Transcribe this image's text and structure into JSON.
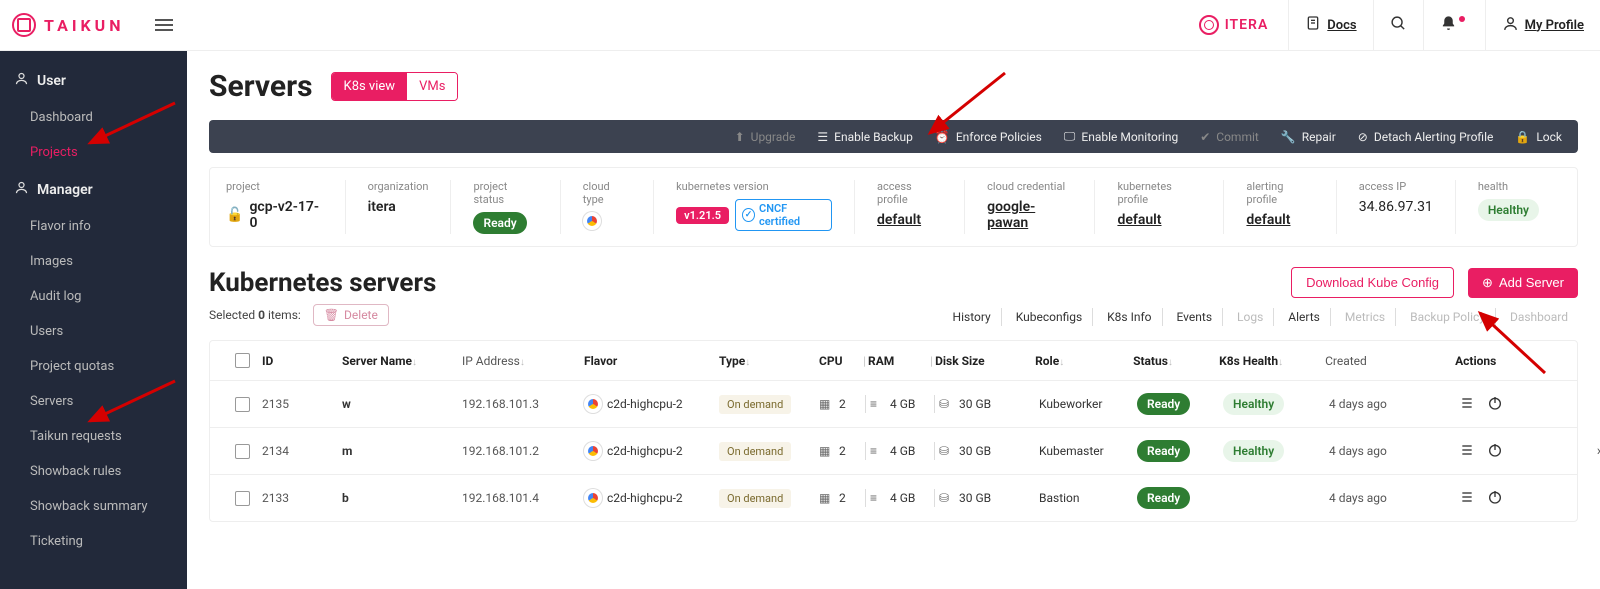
{
  "brand": {
    "name": "TAIKUN",
    "org": "ITERA"
  },
  "header": {
    "docs": "Docs",
    "profile": "My Profile"
  },
  "sidebar": {
    "user_section": "User",
    "manager_section": "Manager",
    "user_items": [
      {
        "label": "Dashboard",
        "active": false
      },
      {
        "label": "Projects",
        "active": true
      }
    ],
    "manager_items": [
      {
        "label": "Flavor info"
      },
      {
        "label": "Images"
      },
      {
        "label": "Audit log"
      },
      {
        "label": "Users"
      },
      {
        "label": "Project quotas"
      },
      {
        "label": "Servers"
      },
      {
        "label": "Taikun requests"
      },
      {
        "label": "Showback rules"
      },
      {
        "label": "Showback summary"
      },
      {
        "label": "Ticketing"
      }
    ]
  },
  "page_title": "Servers",
  "view_tabs": {
    "k8s": "K8s view",
    "vms": "VMs"
  },
  "action_bar": {
    "upgrade": "Upgrade",
    "enable_backup": "Enable Backup",
    "enforce_policies": "Enforce Policies",
    "enable_monitoring": "Enable Monitoring",
    "commit": "Commit",
    "repair": "Repair",
    "detach_alerting": "Detach Alerting Profile",
    "lock": "Lock"
  },
  "meta": {
    "project_lbl": "project",
    "project": "gcp-v2-17-0",
    "org_lbl": "organization",
    "org": "itera",
    "status_lbl": "project status",
    "status": "Ready",
    "cloud_lbl": "cloud type",
    "kver_lbl": "kubernetes version",
    "kver": "v1.21.5",
    "kcert": "CNCF certified",
    "access_lbl": "access profile",
    "access": "default",
    "cred_lbl": "cloud credential",
    "cred": "google-pawan",
    "kprofile_lbl": "kubernetes profile",
    "kprofile": "default",
    "alert_lbl": "alerting profile",
    "alert": "default",
    "ip_lbl": "access IP",
    "ip": "34.86.97.31",
    "health_lbl": "health",
    "health": "Healthy"
  },
  "sub_title": "Kubernetes servers",
  "buttons": {
    "download": "Download Kube Config",
    "add": "Add Server",
    "delete": "Delete"
  },
  "selected": {
    "prefix": "Selected ",
    "count": "0",
    "suffix": " items:"
  },
  "links": {
    "history": "History",
    "kubeconfigs": "Kubeconfigs",
    "k8sinfo": "K8s Info",
    "events": "Events",
    "logs": "Logs",
    "alerts": "Alerts",
    "metrics": "Metrics",
    "backup": "Backup Policy",
    "dashboard": "Dashboard"
  },
  "cols": {
    "id": "ID",
    "name": "Server Name",
    "ip": "IP Address",
    "flavor": "Flavor",
    "type": "Type",
    "cpu": "CPU",
    "ram": "RAM",
    "disk": "Disk Size",
    "role": "Role",
    "status": "Status",
    "health": "K8s Health",
    "created": "Created",
    "actions": "Actions"
  },
  "rows": [
    {
      "id": "2135",
      "name": "w",
      "ip": "192.168.101.3",
      "flavor": "c2d-highcpu-2",
      "type": "On demand",
      "cpu": "2",
      "ram": "4 GB",
      "disk": "30 GB",
      "role": "Kubeworker",
      "status": "Ready",
      "health": "Healthy",
      "created": "4 days ago"
    },
    {
      "id": "2134",
      "name": "m",
      "ip": "192.168.101.2",
      "flavor": "c2d-highcpu-2",
      "type": "On demand",
      "cpu": "2",
      "ram": "4 GB",
      "disk": "30 GB",
      "role": "Kubemaster",
      "status": "Ready",
      "health": "Healthy",
      "created": "4 days ago"
    },
    {
      "id": "2133",
      "name": "b",
      "ip": "192.168.101.4",
      "flavor": "c2d-highcpu-2",
      "type": "On demand",
      "cpu": "2",
      "ram": "4 GB",
      "disk": "30 GB",
      "role": "Bastion",
      "status": "Ready",
      "health": "",
      "created": "4 days ago"
    }
  ]
}
